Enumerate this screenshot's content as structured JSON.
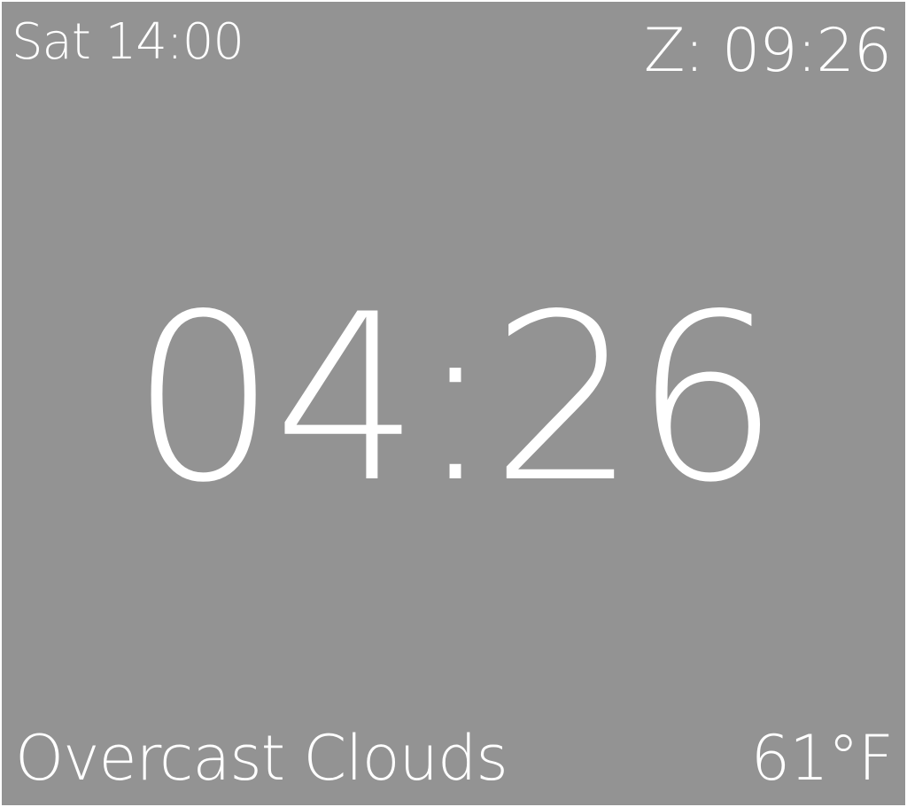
{
  "screen": {
    "background_color": "#939393",
    "text_color": "#ffffff",
    "local_day_time": "Sat 14:00",
    "zulu_time": "Z: 09:26",
    "main_time": "04:26",
    "weather_condition": "Overcast Clouds",
    "temperature": "61°F"
  }
}
